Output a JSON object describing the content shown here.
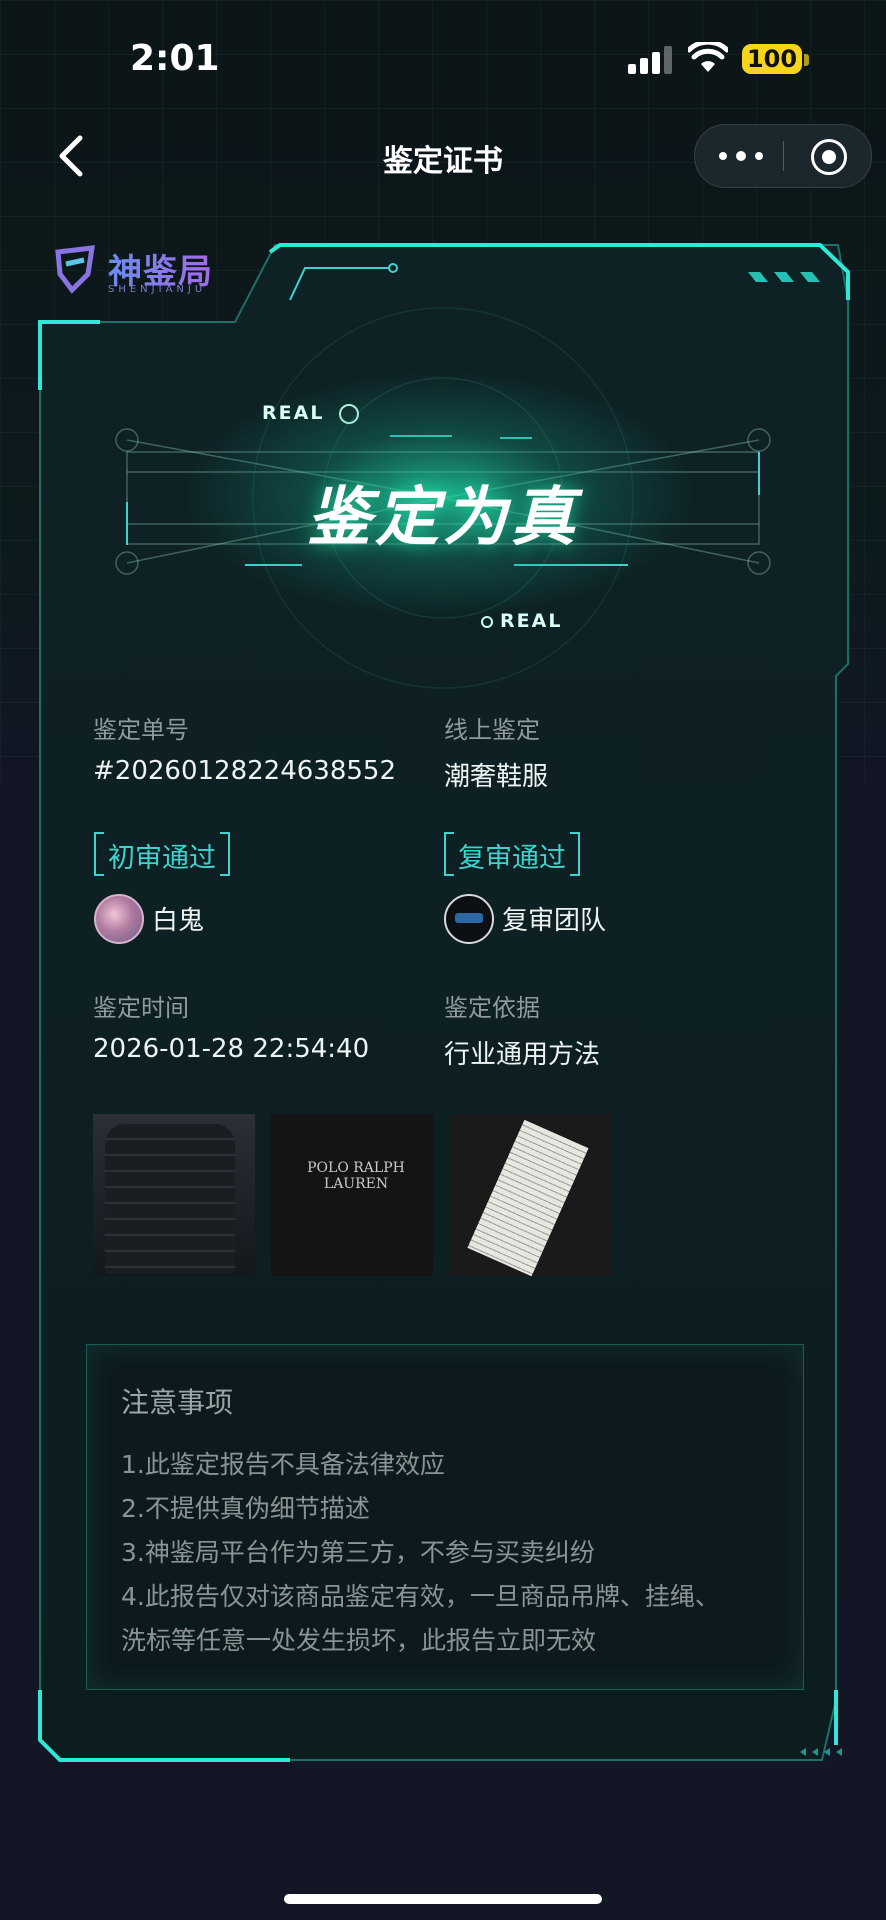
{
  "status_bar": {
    "time": "2:01",
    "battery": "100"
  },
  "nav": {
    "title": "鉴定证书"
  },
  "logo": {
    "name": "神鉴局",
    "sub": "SHENJIANJU"
  },
  "hero": {
    "title": "鉴定为真",
    "tag_a": "REAL",
    "tag_b": "REAL"
  },
  "fields": {
    "order_label": "鉴定单号",
    "order_value": "#20260128224638552",
    "type_label": "线上鉴定",
    "type_value": "潮奢鞋服",
    "first_review": "初审通过",
    "first_reviewer": "白鬼",
    "second_review": "复审通过",
    "second_reviewer": "复审团队",
    "time_label": "鉴定时间",
    "time_value": "2026-01-28 22:54:40",
    "basis_label": "鉴定依据",
    "basis_value": "行业通用方法"
  },
  "photos": [
    {
      "label": ""
    },
    {
      "label": "POLO RALPH LAUREN"
    },
    {
      "label": ""
    }
  ],
  "notice": {
    "title": "注意事项",
    "lines": [
      "1.此鉴定报告不具备法律效应",
      "2.不提供真伪细节描述",
      "3.神鉴局平台作为第三方，不参与买卖纠纷",
      "4.此报告仅对该商品鉴定有效，一旦商品吊牌、挂绳、",
      "洗标等任意一处发生损坏，此报告立即无效"
    ]
  },
  "colors": {
    "accent": "#3fd3cf",
    "glow": "#20dcaa",
    "background": "#121625"
  }
}
